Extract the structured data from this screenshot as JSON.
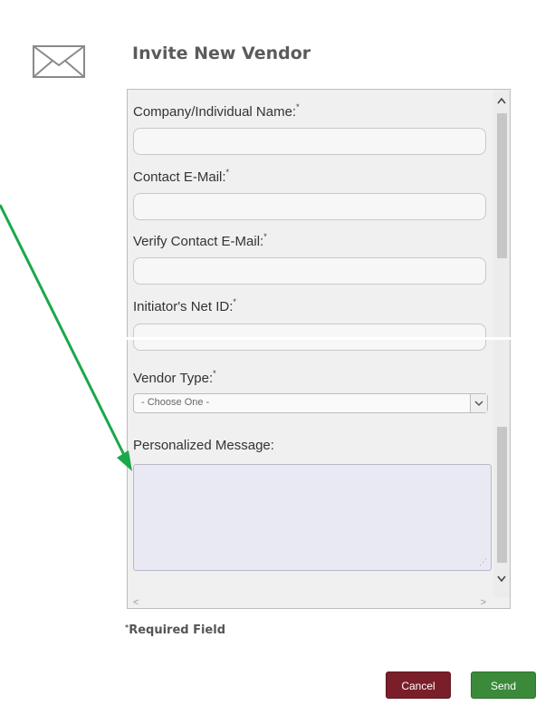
{
  "dialog": {
    "title": "Invite New Vendor",
    "icon": "envelope-icon"
  },
  "form": {
    "fields": [
      {
        "label": "Company/Individual Name:",
        "required_mark": "*",
        "value": ""
      },
      {
        "label": "Contact E-Mail:",
        "required_mark": "*",
        "value": ""
      },
      {
        "label": "Verify Contact E-Mail:",
        "required_mark": "*",
        "value": ""
      },
      {
        "label": "Initiator's Net ID:",
        "required_mark": "*",
        "value": ""
      }
    ],
    "vendor_type": {
      "label": "Vendor Type:",
      "required_mark": "*",
      "selected": "- Choose One -"
    },
    "message": {
      "label": "Personalized Message:",
      "value": ""
    }
  },
  "footer": {
    "required_mark": "*",
    "required_text": "Required Field",
    "cancel_label": "Cancel",
    "send_label": "Send"
  },
  "colors": {
    "cancel_bg": "#7a1f2a",
    "send_bg": "#3a8a3a",
    "annotation_arrow": "#1aa84a"
  }
}
